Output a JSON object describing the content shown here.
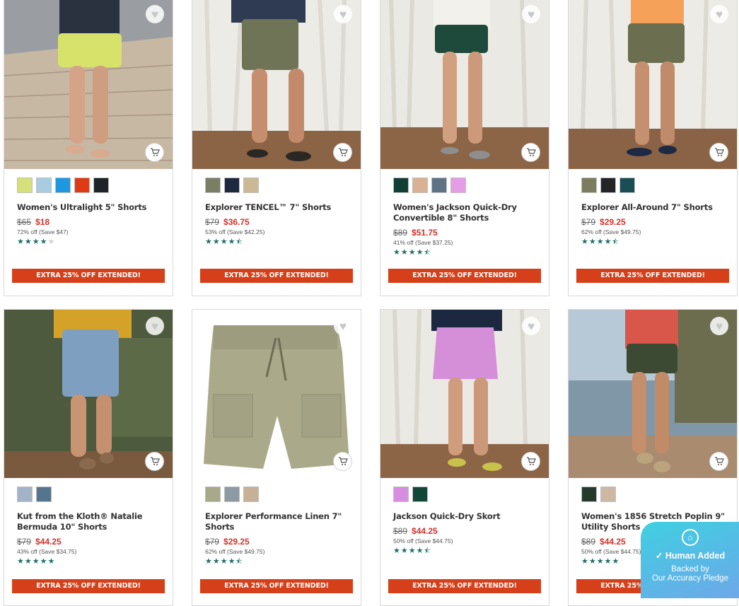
{
  "colors": {
    "accent": "#d5401a",
    "sale_price": "#d3322a",
    "star": "#1f6f6c"
  },
  "products": [
    {
      "name": "Women's Ultralight 5\" Shorts",
      "swatches": [
        "#d6e07a",
        "#a9cde0",
        "#1c97e0",
        "#df3a14",
        "#1f2428"
      ],
      "original_price": "$65",
      "sale_price": "$18",
      "savings": "72% off (Save $47)",
      "rating": 4.0,
      "promo": "EXTRA 25% OFF EXTENDED!"
    },
    {
      "name": "Explorer TENCEL™ 7\" Shorts",
      "swatches": [
        "#7a7e64",
        "#1e2940",
        "#cbb995"
      ],
      "original_price": "$79",
      "sale_price": "$36.75",
      "savings": "53% off (Save $42.25)",
      "rating": 4.5,
      "promo": "EXTRA 25% OFF EXTENDED!"
    },
    {
      "name": "Women's Jackson Quick-Dry Convertible 8\" Shorts",
      "swatches": [
        "#123f33",
        "#d8b292",
        "#5e7486",
        "#e59de6"
      ],
      "original_price": "$89",
      "sale_price": "$51.75",
      "savings": "41% off (Save $37.25)",
      "rating": 4.5,
      "promo": "EXTRA 25% OFF EXTENDED!"
    },
    {
      "name": "Explorer All-Around 7\" Shorts",
      "swatches": [
        "#7c7c5e",
        "#222426",
        "#1b4e54"
      ],
      "original_price": "$79",
      "sale_price": "$29.25",
      "savings": "62% off (Save $49.75)",
      "rating": 4.5,
      "promo": "EXTRA 25% OFF EXTENDED!"
    },
    {
      "name": "Kut from the Kloth® Natalie Bermuda 10\" Shorts",
      "swatches": [
        "#a3b4c6",
        "#55758f"
      ],
      "original_price": "$79",
      "sale_price": "$44.25",
      "savings": "43% off (Save $34.75)",
      "rating": 5.0,
      "promo": "EXTRA 25% OFF EXTENDED!"
    },
    {
      "name": "Explorer Performance Linen 7\" Shorts",
      "swatches": [
        "#a7a98a",
        "#8d9aa1",
        "#c7b096"
      ],
      "original_price": "$79",
      "sale_price": "$29.25",
      "savings": "62% off (Save $49.75)",
      "rating": 4.5,
      "promo": "EXTRA 25% OFF EXTENDED!"
    },
    {
      "name": "Jackson Quick-Dry Skort",
      "swatches": [
        "#d78ee1",
        "#114639"
      ],
      "original_price": "$89",
      "sale_price": "$44.25",
      "savings": "50% off (Save $44.75)",
      "rating": 4.5,
      "promo": "EXTRA 25% OFF EXTENDED!"
    },
    {
      "name": "Women's 1856 Stretch Poplin 9\" Utility Shorts",
      "swatches": [
        "#243b2c",
        "#cdb8a4"
      ],
      "original_price": "$89",
      "sale_price": "$44.25",
      "savings": "50% off (Save $44.75)",
      "rating": 5.0,
      "promo": "EXTRA 25% OFF EXTENDED!"
    }
  ],
  "badge": {
    "line1": "Human Added",
    "line2": "Backed by",
    "line3": "Our Accuracy Pledge",
    "icon": "house-check-icon"
  }
}
